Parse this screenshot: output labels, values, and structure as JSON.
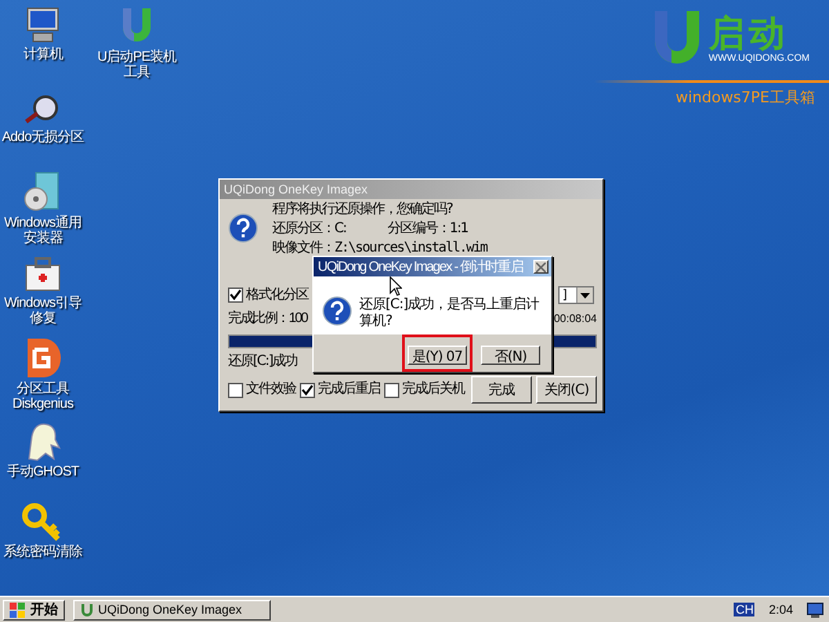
{
  "desktop_icons": [
    {
      "label": "计算机"
    },
    {
      "label": "Addo无损分区"
    },
    {
      "label": "Windows通用安装器"
    },
    {
      "label": "Windows引导修复"
    },
    {
      "label": "分区工具 Diskgenius"
    },
    {
      "label": "手动GHOST"
    },
    {
      "label": "系统密码清除"
    }
  ],
  "desktop_icons_column_2": [
    {
      "label": "U启动PE装机工具"
    }
  ],
  "logo": {
    "brand": "启动",
    "url": "WWW.UQIDONG.COM",
    "subtitle": "windows7PE工具箱"
  },
  "main_dialog": {
    "title": "UQiDong OneKey Imagex",
    "question": "程序将执行还原操作，您确定吗?",
    "partition": "还原分区：C:",
    "partition_number": "分区编号：1:1",
    "image_file": "映像文件：Z:\\sources\\install.wim",
    "format": {
      "label": "格式化分区",
      "checked": true
    },
    "dropdown_value": "]",
    "progress_label": "完成比例：100",
    "time": "00:08:04",
    "progress": {
      "level": 1
    },
    "status": "还原[C:]成功",
    "options": [
      {
        "label": "文件效验",
        "checked": false
      },
      {
        "label": "完成后重启",
        "checked": true
      },
      {
        "label": "完成后关机",
        "checked": false
      }
    ],
    "buttons": [
      "完成",
      "关闭(C)"
    ]
  },
  "confirm_dialog": {
    "title": "UQiDong OneKey Imagex - 倒计时重启",
    "message": "还原[C:]成功，是否马上重启计算机?",
    "buttons": [
      {
        "label": "是(Y) 07",
        "highlighted": true
      },
      {
        "label": "否(N)",
        "highlighted": false
      }
    ]
  },
  "taskbar": {
    "start": "开始",
    "task": "UQiDong OneKey Imagex",
    "language": "CH",
    "time": "2:04"
  }
}
